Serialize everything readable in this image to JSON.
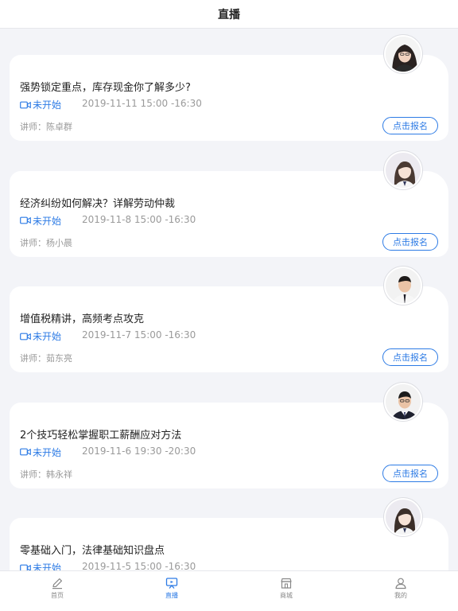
{
  "header": {
    "title": "直播"
  },
  "colors": {
    "accent": "#2d7be5",
    "muted": "#9a9a9a",
    "background": "#f3f4f8"
  },
  "courses": [
    {
      "title": "强势锁定重点，库存现金你了解多少?",
      "status": "未开始",
      "time": "2019-11-11 15:00 -16:30",
      "lecturer": "讲师：陈卓群",
      "button": "点击报名",
      "avatar": "female-dark-hair-photo"
    },
    {
      "title": "经济纠纷如何解决？详解劳动仲裁",
      "status": "未开始",
      "time": "2019-11-8 15:00 -16:30",
      "lecturer": "讲师：杨小晨",
      "button": "点击报名",
      "avatar": "female-photo"
    },
    {
      "title": "增值税精讲，高频考点攻克",
      "status": "未开始",
      "time": "2019-11-7 15:00 -16:30",
      "lecturer": "讲师：茹东亮",
      "button": "点击报名",
      "avatar": "male-photo"
    },
    {
      "title": "2个技巧轻松掌握职工薪酬应对方法",
      "status": "未开始",
      "time": "2019-11-6 19:30 -20:30",
      "lecturer": "讲师：韩永祥",
      "button": "点击报名",
      "avatar": "male-glasses-photo"
    },
    {
      "title": "零基础入门，法律基础知识盘点",
      "status": "未开始",
      "time": "2019-11-5 15:00 -16:30",
      "lecturer": "",
      "button": "",
      "avatar": "female-photo"
    }
  ],
  "tabbar": [
    {
      "label": "首页",
      "icon": "edit-icon",
      "active": false
    },
    {
      "label": "直播",
      "icon": "live-icon",
      "active": true
    },
    {
      "label": "商城",
      "icon": "store-icon",
      "active": false
    },
    {
      "label": "我的",
      "icon": "user-icon",
      "active": false
    }
  ]
}
